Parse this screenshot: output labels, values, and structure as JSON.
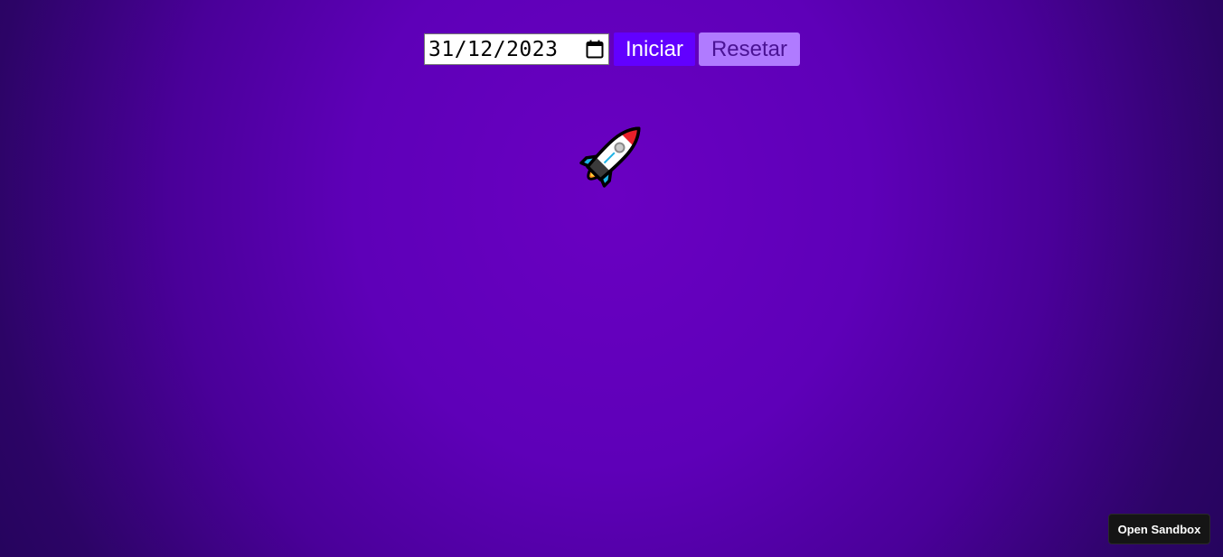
{
  "countdown": {
    "date_input_value": "31/12/2023",
    "start_label": "Iniciar",
    "reset_label": "Resetar"
  },
  "decor": {
    "rocket_icon": "rocket-icon",
    "calendar_icon": "calendar-icon"
  },
  "sandbox": {
    "open_label": "Open Sandbox"
  },
  "colors": {
    "background_center": "#6a00c2",
    "background_edge": "#23045a",
    "start_button": "#6200ff",
    "reset_button": "#b07bff",
    "reset_text": "#4a1394"
  }
}
